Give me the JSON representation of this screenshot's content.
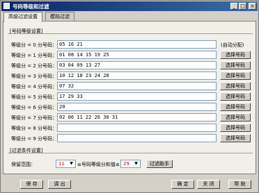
{
  "window": {
    "title": "号码等级和过滤",
    "buttons": {
      "minimize": "_",
      "maximize": "□",
      "close": "×"
    }
  },
  "tabs": [
    {
      "label": "高级过滤设置"
    },
    {
      "label": "模拟过滤"
    }
  ],
  "grade_group": {
    "title": "[号码等级设置]",
    "rows": [
      {
        "label": "等级分 = 0  分号码：",
        "value": "05 16 21",
        "action": "(自动分配)"
      },
      {
        "label": "等级分 = 1  分号码：",
        "value": "01 08 14 15 19 25",
        "action": "选择号码"
      },
      {
        "label": "等级分 = 2  分号码：",
        "value": "03 04 09 13 27",
        "action": "选择号码"
      },
      {
        "label": "等级分 = 3  分号码：",
        "value": "10 12 18 23 24 28",
        "action": "选择号码"
      },
      {
        "label": "等级分 = 4  分号码：",
        "value": "07 32",
        "action": "选择号码"
      },
      {
        "label": "等级分 = 5  分号码：",
        "value": "17 29 33",
        "action": "选择号码"
      },
      {
        "label": "等级分 = 6  分号码：",
        "value": "20",
        "action": "选择号码"
      },
      {
        "label": "等级分 = 7  分号码：",
        "value": "02 06 11 22 26 30 31",
        "action": "选择号码"
      },
      {
        "label": "等级分 = 8  分号码：",
        "value": "",
        "action": "选择号码"
      },
      {
        "label": "等级分 = 9  分号码：",
        "value": "",
        "action": "选择号码"
      }
    ]
  },
  "filter_group": {
    "title": "[过滤条件设置]",
    "range_label": "保留范围：",
    "min_value": "11",
    "middle_text": "≤号码等级分和值≤",
    "max_value": "29",
    "helper_button": "过滤助手"
  },
  "bottom_buttons": {
    "save": "保 存",
    "load": "调 出",
    "ok": "确 定",
    "close": "关 闭",
    "help": "帮 助"
  }
}
